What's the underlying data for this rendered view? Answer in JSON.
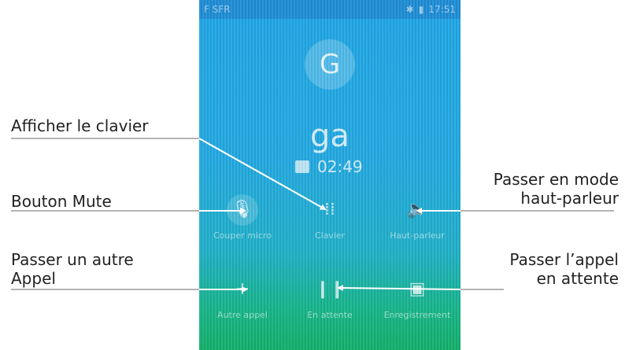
{
  "phone": {
    "status": {
      "carrier": "F SFR",
      "time": "17:51"
    },
    "avatar_letter": "G",
    "caller_name": "ga",
    "call_timer": "02:49",
    "controls": {
      "mute": {
        "label": "Couper micro",
        "icon": "microphone-off-icon"
      },
      "keypad": {
        "label": "Clavier",
        "icon": "dialpad-icon"
      },
      "speaker": {
        "label": "Haut-parleur",
        "icon": "speaker-icon"
      },
      "add_call": {
        "label": "Autre appel",
        "icon": "plus-icon"
      },
      "hold": {
        "label": "En attente",
        "icon": "pause-icon"
      },
      "record": {
        "label": "Enregistrement",
        "icon": "record-icon"
      }
    }
  },
  "annotations": {
    "keypad": "Afficher le clavier",
    "mute": "Bouton Mute",
    "add_call_line1": "Passer un autre",
    "add_call_line2": "Appel",
    "speaker_line1": "Passer en mode",
    "speaker_line2": "haut-parleur",
    "hold_line1": "Passer l’appel",
    "hold_line2": "en attente"
  },
  "colors": {
    "annotation_line": "#9a9a9a",
    "arrow_stroke": "#ffffff"
  }
}
